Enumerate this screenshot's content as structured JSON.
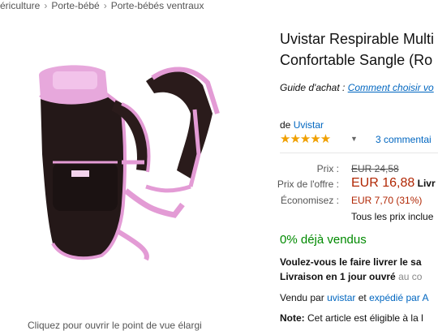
{
  "breadcrumb": {
    "items": [
      "ériculture",
      "Porte-bébé",
      "Porte-bébés ventraux"
    ],
    "separator": "›"
  },
  "product": {
    "title_line1": "Uvistar Respirable Multi",
    "title_line2": "Confortable Sangle (Ro",
    "guide_prefix": "Guide d'achat :",
    "guide_link": "Comment choisir vo",
    "brand_prefix": "de",
    "brand_name": "Uvistar",
    "rating_stars": "★★★★★",
    "rating_value": 5,
    "reviews_link": "3 commentai"
  },
  "pricing": {
    "list_label": "Prix :",
    "list_value": "EUR 24,58",
    "offer_label": "Prix de l'offre :",
    "offer_value": "EUR 16,88",
    "offer_suffix": "Livr",
    "savings_label": "Économisez :",
    "savings_value": "EUR 7,70 (31%)",
    "tax_note": "Tous les prix inclue"
  },
  "deal": {
    "sold_text": "0% déjà vendus",
    "delivery_q": "Voulez-vous le faire livrer le sa",
    "delivery_line2_bold": "Livraison en 1 jour ouvré",
    "delivery_line2_rest": "au co"
  },
  "seller": {
    "sold_by": "Vendu par",
    "seller_link": "uvistar",
    "and": "et",
    "shipped_by": "expédié par A"
  },
  "note": {
    "label": "Note:",
    "text": "Cet article est éligible à la l"
  },
  "image": {
    "caption": "Cliquez pour ouvrir le point de vue élargi"
  },
  "colors": {
    "link": "#0066c0",
    "price_red": "#b12704",
    "green": "#008a00",
    "star": "#f0a000"
  }
}
